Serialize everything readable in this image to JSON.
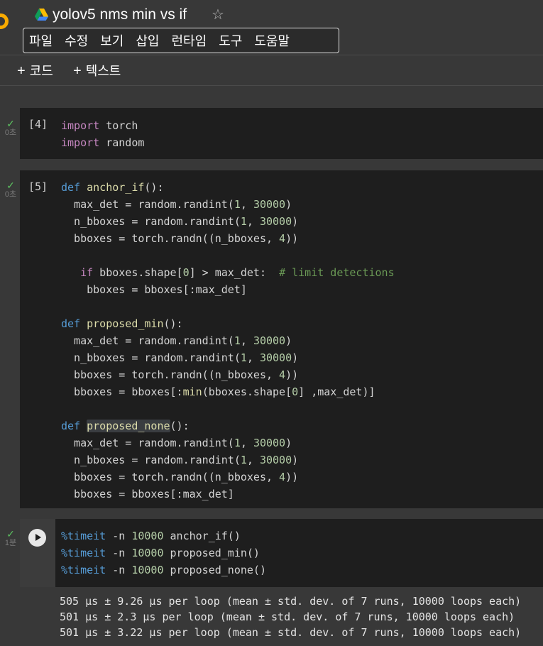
{
  "header": {
    "title": "yolov5 nms min vs if",
    "menu": [
      "파일",
      "수정",
      "보기",
      "삽입",
      "런타임",
      "도구",
      "도움말"
    ]
  },
  "toolbar": {
    "add_code": "코드",
    "add_text": "텍스트"
  },
  "cells": [
    {
      "count": "[4]",
      "exec_time": "0초"
    },
    {
      "count": "[5]",
      "exec_time": "0초"
    },
    {
      "exec_time": "1분"
    }
  ],
  "cell3": {
    "lines": [
      {
        "magic": "%timeit",
        "rest_a": " -n ",
        "num": "10000",
        "rest_b": " anchor_if()"
      },
      {
        "magic": "%timeit",
        "rest_a": " -n ",
        "num": "10000",
        "rest_b": " proposed_min()"
      },
      {
        "magic": "%timeit",
        "rest_a": " -n ",
        "num": "10000",
        "rest_b": " proposed_none()"
      }
    ]
  },
  "output": {
    "lines": [
      "505 µs ± 9.26 µs per loop (mean ± std. dev. of 7 runs, 10000 loops each)",
      "501 µs ± 2.3 µs per loop (mean ± std. dev. of 7 runs, 10000 loops each)",
      "501 µs ± 3.22 µs per loop (mean ± std. dev. of 7 runs, 10000 loops each)"
    ]
  },
  "code": {
    "c4": {
      "kw": "import",
      "l1": " torch",
      "l2": " random"
    },
    "c5": {
      "def": "def",
      "if": "if",
      "f1": "anchor_if",
      "f2": "proposed_min",
      "f3": "proposed_none",
      "paren": "():",
      "max_det": "  max_det = random.randint(",
      "n_bboxes": "  n_bboxes = random.randint(",
      "bboxes_randn": "  bboxes = torch.randn((n_bboxes, ",
      "one": "1",
      "comma": ", ",
      "big": "30000",
      "four": "4",
      "close1": ")",
      "close2": "))",
      "if_pre": "   ",
      "if_mid": " bboxes.shape[",
      "zero": "0",
      "if_post": "] > max_det:  ",
      "comment": "# limit detections",
      "slice_if": "    bboxes = bboxes[:max_det]",
      "min_pre": "  bboxes = bboxes[:",
      "min_fn": "min",
      "min_mid": "(bboxes.shape[",
      "min_post": "] ,max_det)]",
      "slice_none": "  bboxes = bboxes[:max_det]"
    }
  }
}
